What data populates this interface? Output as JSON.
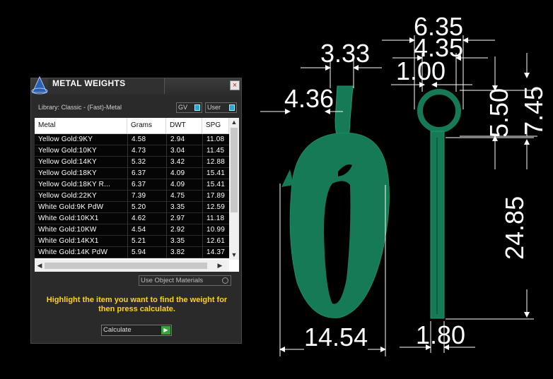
{
  "panel": {
    "title": "METAL WEIGHTS",
    "close_label": "×",
    "library_label": "Library: Classic - (Fast)-Metal",
    "toggles": {
      "gv": "GV",
      "user": "User"
    },
    "table": {
      "columns": [
        "Metal",
        "Grams",
        "DWT",
        "SPG"
      ],
      "rows": [
        [
          "Yellow Gold:9KY",
          "4.58",
          "2.94",
          "11.08"
        ],
        [
          "Yellow Gold:10KY",
          "4.73",
          "3.04",
          "11.45"
        ],
        [
          "Yellow Gold:14KY",
          "5.32",
          "3.42",
          "12.88"
        ],
        [
          "Yellow Gold:18KY",
          "6.37",
          "4.09",
          "15.41"
        ],
        [
          "Yellow Gold:18KY R...",
          "6.37",
          "4.09",
          "15.41"
        ],
        [
          "Yellow Gold:22KY",
          "7.39",
          "4.75",
          "17.89"
        ],
        [
          "White Gold:9K PdW",
          "5.20",
          "3.35",
          "12.59"
        ],
        [
          "White Gold:10KX1",
          "4.62",
          "2.97",
          "11.18"
        ],
        [
          "White Gold:10KW",
          "4.54",
          "2.92",
          "10.99"
        ],
        [
          "White Gold:14KX1",
          "5.21",
          "3.35",
          "12.61"
        ],
        [
          "White Gold:14K PdW",
          "5.94",
          "3.82",
          "14.37"
        ]
      ]
    },
    "use_object_materials": "Use Object Materials",
    "instruction": "Highlight the item you want to find the weight for then press calculate.",
    "calculate_label": "Calculate"
  },
  "dimensions": {
    "d_6_35": "6.35",
    "d_3_33": "3.33",
    "d_4_35": "4.35",
    "d_1_00": "1.00",
    "d_4_36": "4.36",
    "d_5_50": "5.50",
    "d_7_45": "7.45",
    "d_24_85": "24.85",
    "d_14_54": "14.54",
    "d_1_80": "1.80"
  },
  "colors": {
    "model": "#157a55",
    "dimension": "#ffffff",
    "instruction": "#ffd21a"
  }
}
